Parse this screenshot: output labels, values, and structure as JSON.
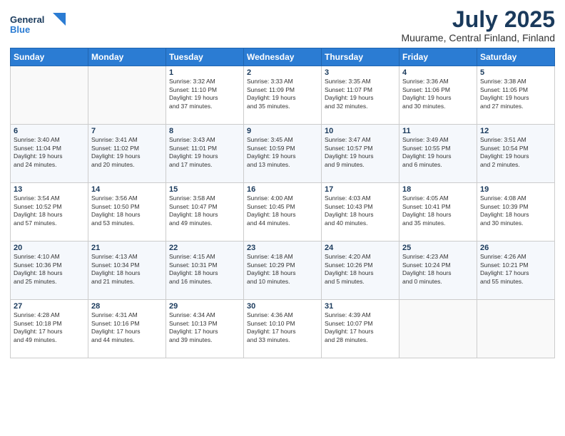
{
  "logo": {
    "line1": "General",
    "line2": "Blue",
    "icon_label": "general-blue-logo"
  },
  "title": "July 2025",
  "location": "Muurame, Central Finland, Finland",
  "weekdays": [
    "Sunday",
    "Monday",
    "Tuesday",
    "Wednesday",
    "Thursday",
    "Friday",
    "Saturday"
  ],
  "weeks": [
    [
      {
        "day": "",
        "info": ""
      },
      {
        "day": "",
        "info": ""
      },
      {
        "day": "1",
        "info": "Sunrise: 3:32 AM\nSunset: 11:10 PM\nDaylight: 19 hours\nand 37 minutes."
      },
      {
        "day": "2",
        "info": "Sunrise: 3:33 AM\nSunset: 11:09 PM\nDaylight: 19 hours\nand 35 minutes."
      },
      {
        "day": "3",
        "info": "Sunrise: 3:35 AM\nSunset: 11:07 PM\nDaylight: 19 hours\nand 32 minutes."
      },
      {
        "day": "4",
        "info": "Sunrise: 3:36 AM\nSunset: 11:06 PM\nDaylight: 19 hours\nand 30 minutes."
      },
      {
        "day": "5",
        "info": "Sunrise: 3:38 AM\nSunset: 11:05 PM\nDaylight: 19 hours\nand 27 minutes."
      }
    ],
    [
      {
        "day": "6",
        "info": "Sunrise: 3:40 AM\nSunset: 11:04 PM\nDaylight: 19 hours\nand 24 minutes."
      },
      {
        "day": "7",
        "info": "Sunrise: 3:41 AM\nSunset: 11:02 PM\nDaylight: 19 hours\nand 20 minutes."
      },
      {
        "day": "8",
        "info": "Sunrise: 3:43 AM\nSunset: 11:01 PM\nDaylight: 19 hours\nand 17 minutes."
      },
      {
        "day": "9",
        "info": "Sunrise: 3:45 AM\nSunset: 10:59 PM\nDaylight: 19 hours\nand 13 minutes."
      },
      {
        "day": "10",
        "info": "Sunrise: 3:47 AM\nSunset: 10:57 PM\nDaylight: 19 hours\nand 9 minutes."
      },
      {
        "day": "11",
        "info": "Sunrise: 3:49 AM\nSunset: 10:55 PM\nDaylight: 19 hours\nand 6 minutes."
      },
      {
        "day": "12",
        "info": "Sunrise: 3:51 AM\nSunset: 10:54 PM\nDaylight: 19 hours\nand 2 minutes."
      }
    ],
    [
      {
        "day": "13",
        "info": "Sunrise: 3:54 AM\nSunset: 10:52 PM\nDaylight: 18 hours\nand 57 minutes."
      },
      {
        "day": "14",
        "info": "Sunrise: 3:56 AM\nSunset: 10:50 PM\nDaylight: 18 hours\nand 53 minutes."
      },
      {
        "day": "15",
        "info": "Sunrise: 3:58 AM\nSunset: 10:47 PM\nDaylight: 18 hours\nand 49 minutes."
      },
      {
        "day": "16",
        "info": "Sunrise: 4:00 AM\nSunset: 10:45 PM\nDaylight: 18 hours\nand 44 minutes."
      },
      {
        "day": "17",
        "info": "Sunrise: 4:03 AM\nSunset: 10:43 PM\nDaylight: 18 hours\nand 40 minutes."
      },
      {
        "day": "18",
        "info": "Sunrise: 4:05 AM\nSunset: 10:41 PM\nDaylight: 18 hours\nand 35 minutes."
      },
      {
        "day": "19",
        "info": "Sunrise: 4:08 AM\nSunset: 10:39 PM\nDaylight: 18 hours\nand 30 minutes."
      }
    ],
    [
      {
        "day": "20",
        "info": "Sunrise: 4:10 AM\nSunset: 10:36 PM\nDaylight: 18 hours\nand 25 minutes."
      },
      {
        "day": "21",
        "info": "Sunrise: 4:13 AM\nSunset: 10:34 PM\nDaylight: 18 hours\nand 21 minutes."
      },
      {
        "day": "22",
        "info": "Sunrise: 4:15 AM\nSunset: 10:31 PM\nDaylight: 18 hours\nand 16 minutes."
      },
      {
        "day": "23",
        "info": "Sunrise: 4:18 AM\nSunset: 10:29 PM\nDaylight: 18 hours\nand 10 minutes."
      },
      {
        "day": "24",
        "info": "Sunrise: 4:20 AM\nSunset: 10:26 PM\nDaylight: 18 hours\nand 5 minutes."
      },
      {
        "day": "25",
        "info": "Sunrise: 4:23 AM\nSunset: 10:24 PM\nDaylight: 18 hours\nand 0 minutes."
      },
      {
        "day": "26",
        "info": "Sunrise: 4:26 AM\nSunset: 10:21 PM\nDaylight: 17 hours\nand 55 minutes."
      }
    ],
    [
      {
        "day": "27",
        "info": "Sunrise: 4:28 AM\nSunset: 10:18 PM\nDaylight: 17 hours\nand 49 minutes."
      },
      {
        "day": "28",
        "info": "Sunrise: 4:31 AM\nSunset: 10:16 PM\nDaylight: 17 hours\nand 44 minutes."
      },
      {
        "day": "29",
        "info": "Sunrise: 4:34 AM\nSunset: 10:13 PM\nDaylight: 17 hours\nand 39 minutes."
      },
      {
        "day": "30",
        "info": "Sunrise: 4:36 AM\nSunset: 10:10 PM\nDaylight: 17 hours\nand 33 minutes."
      },
      {
        "day": "31",
        "info": "Sunrise: 4:39 AM\nSunset: 10:07 PM\nDaylight: 17 hours\nand 28 minutes."
      },
      {
        "day": "",
        "info": ""
      },
      {
        "day": "",
        "info": ""
      }
    ]
  ]
}
